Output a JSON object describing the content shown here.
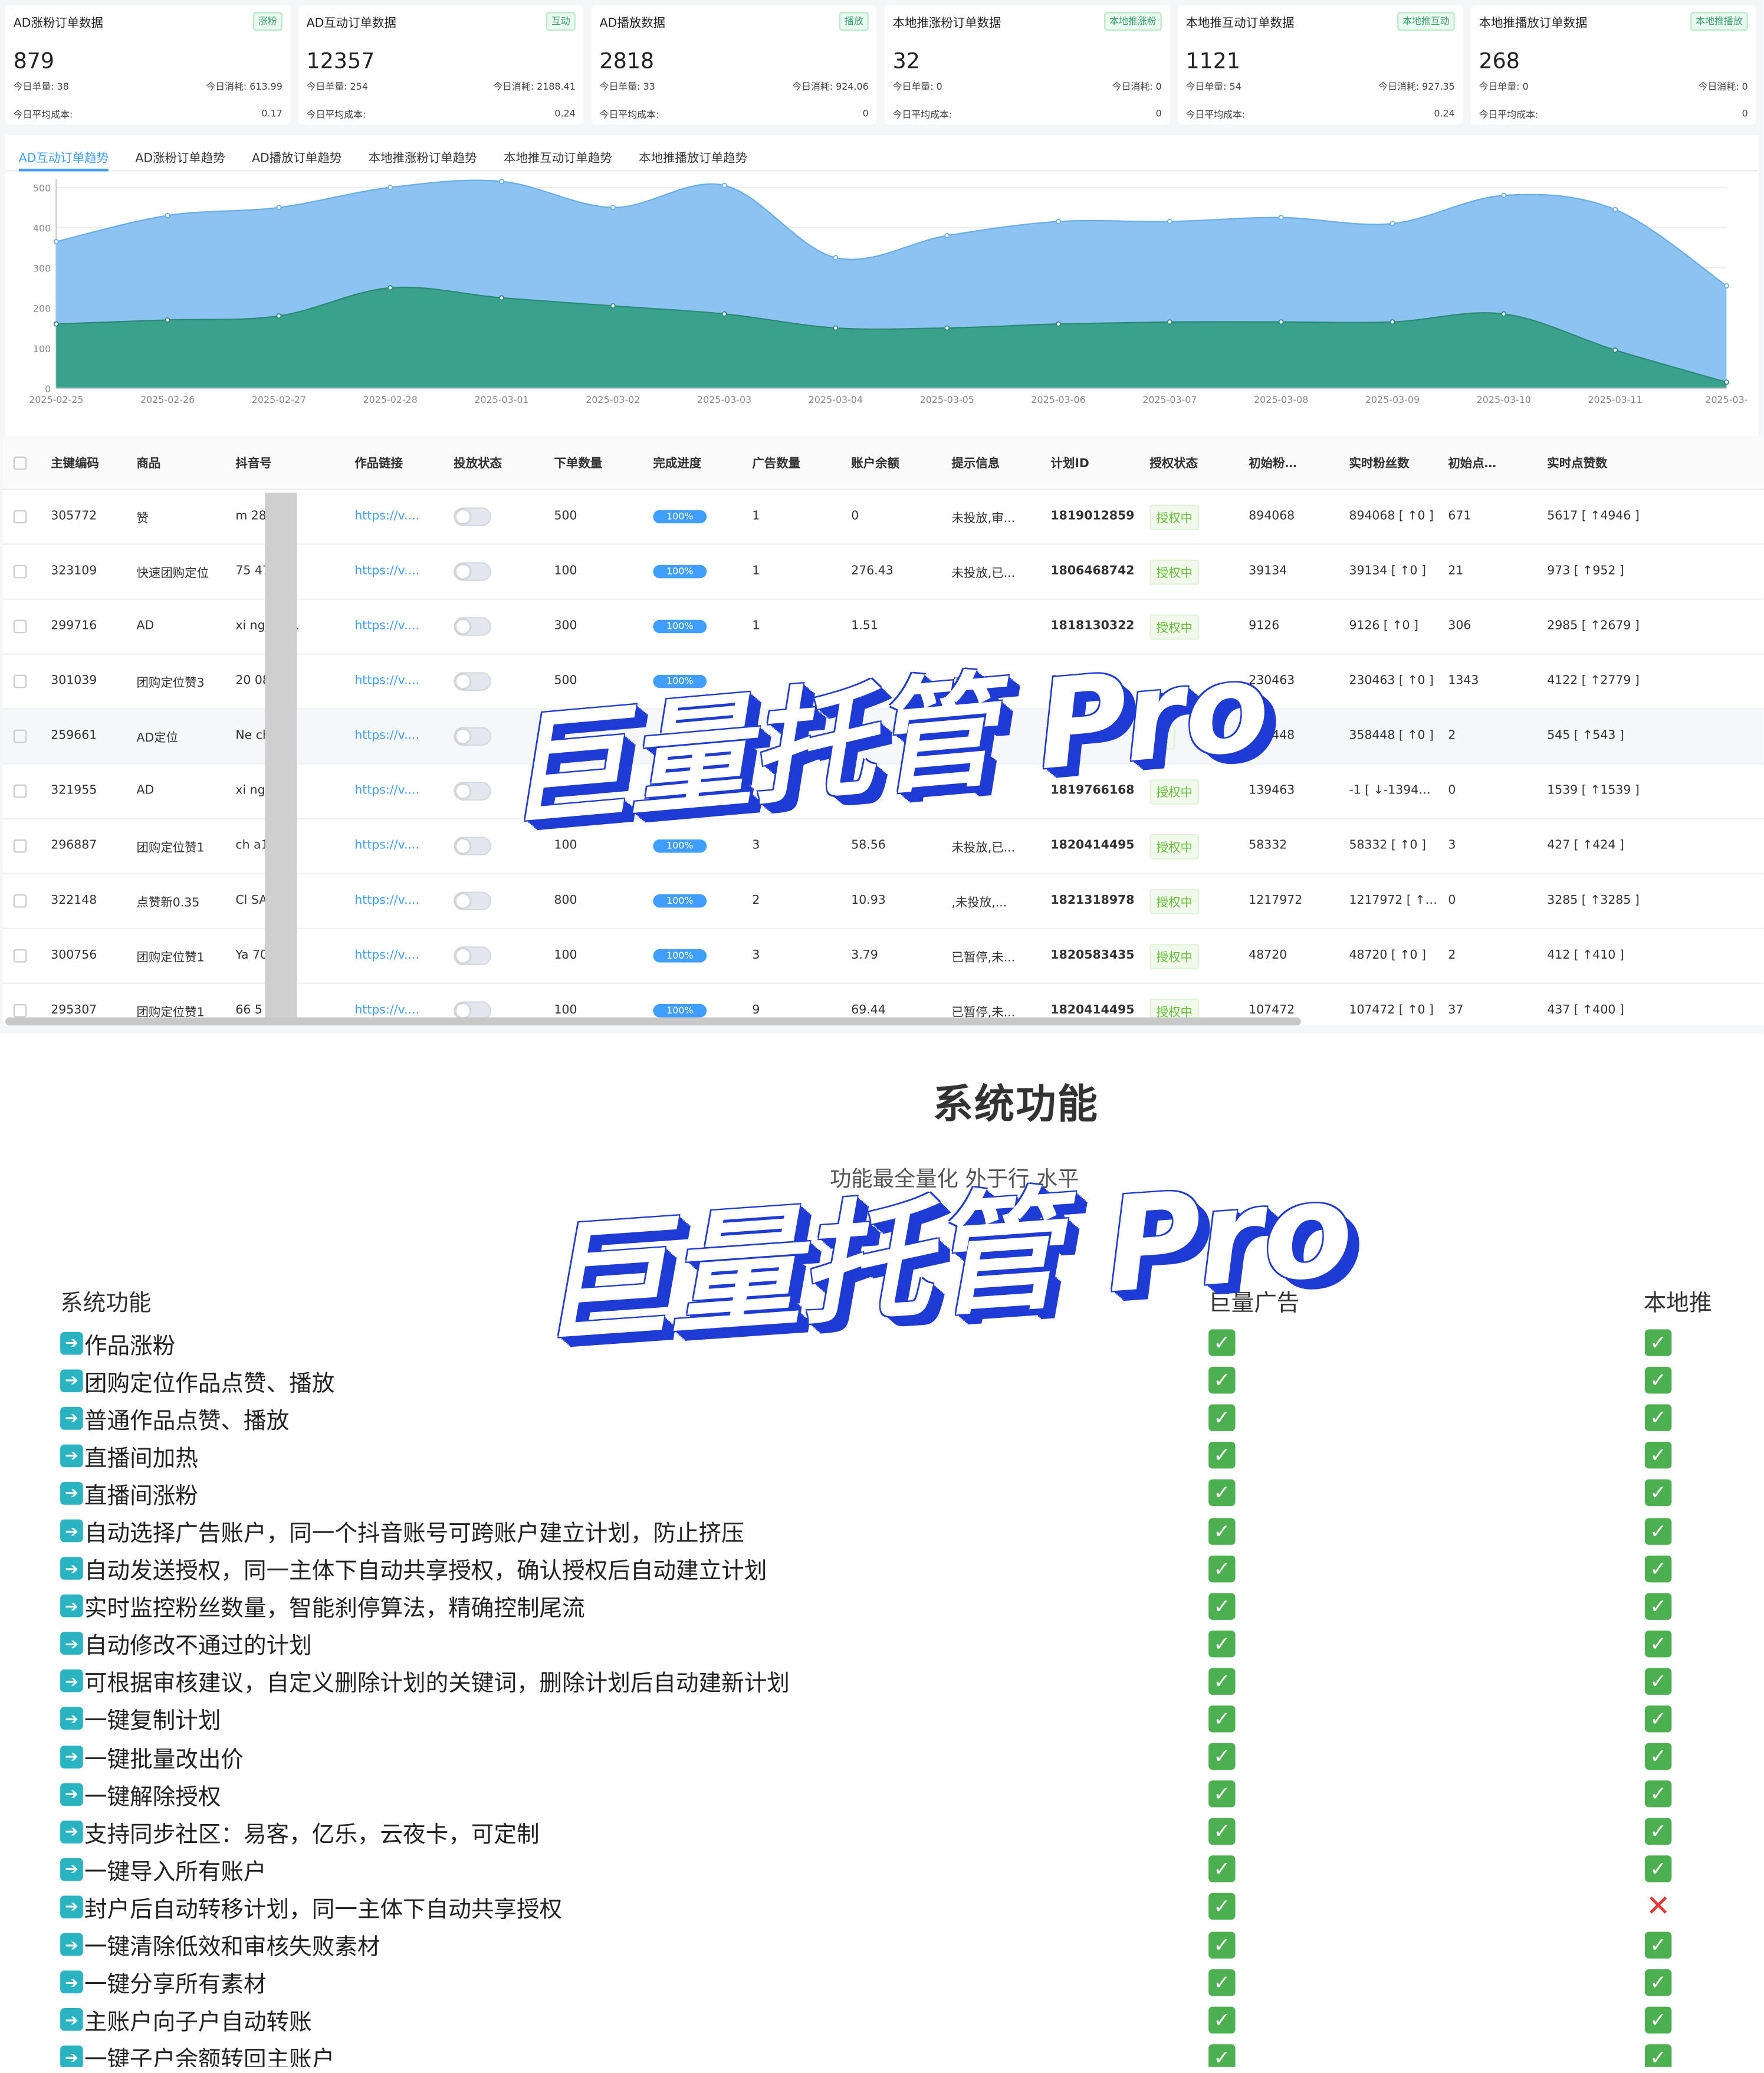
{
  "cards": [
    {
      "title": "AD涨粉订单数据",
      "tag": "涨粉",
      "value": "879",
      "orders": "今日单量: 38",
      "cost": "今日消耗: 613.99",
      "avg_label": "今日平均成本:",
      "avg": "0.17"
    },
    {
      "title": "AD互动订单数据",
      "tag": "互动",
      "value": "12357",
      "orders": "今日单量: 254",
      "cost": "今日消耗: 2188.41",
      "avg_label": "今日平均成本:",
      "avg": "0.24"
    },
    {
      "title": "AD播放数据",
      "tag": "播放",
      "value": "2818",
      "orders": "今日单量: 33",
      "cost": "今日消耗: 924.06",
      "avg_label": "今日平均成本:",
      "avg": "0"
    },
    {
      "title": "本地推涨粉订单数据",
      "tag": "本地推涨粉",
      "value": "32",
      "orders": "今日单量: 0",
      "cost": "今日消耗: 0",
      "avg_label": "今日平均成本:",
      "avg": "0"
    },
    {
      "title": "本地推互动订单数据",
      "tag": "本地推互动",
      "value": "1121",
      "orders": "今日单量: 54",
      "cost": "今日消耗: 927.35",
      "avg_label": "今日平均成本:",
      "avg": "0.24"
    },
    {
      "title": "本地推播放订单数据",
      "tag": "本地推播放",
      "value": "268",
      "orders": "今日单量: 0",
      "cost": "今日消耗: 0",
      "avg_label": "今日平均成本:",
      "avg": "0"
    }
  ],
  "tabs": [
    "AD互动订单趋势",
    "AD涨粉订单趋势",
    "AD播放订单趋势",
    "本地推涨粉订单趋势",
    "本地推互动订单趋势",
    "本地推播放订单趋势"
  ],
  "chart_data": {
    "type": "area",
    "x": [
      "2025-02-25",
      "2025-02-26",
      "2025-02-27",
      "2025-02-28",
      "2025-03-01",
      "2025-03-02",
      "2025-03-03",
      "2025-03-04",
      "2025-03-05",
      "2025-03-06",
      "2025-03-07",
      "2025-03-08",
      "2025-03-09",
      "2025-03-10",
      "2025-03-11",
      "2025-03-"
    ],
    "yticks": [
      "0",
      "100",
      "200",
      "300",
      "400",
      "500"
    ],
    "ylim": [
      0,
      500
    ],
    "series": [
      {
        "values": [
          365,
          430,
          450,
          500,
          515,
          450,
          505,
          325,
          380,
          415,
          415,
          425,
          410,
          480,
          445,
          255
        ],
        "color": "#8cc3f2"
      },
      {
        "values": [
          160,
          170,
          180,
          250,
          225,
          205,
          185,
          150,
          150,
          160,
          165,
          165,
          165,
          185,
          95,
          15
        ],
        "color": "#3aa18c"
      }
    ]
  },
  "table": {
    "headers": [
      "主键编码",
      "商品",
      "抖音号",
      "作品链接",
      "投放状态",
      "下单数量",
      "完成进度",
      "广告数量",
      "账户余额",
      "提示信息",
      "计划ID",
      "授权状态",
      "初始粉…",
      "实时粉丝数",
      "初始点…",
      "实时点赞数"
    ],
    "rows": [
      [
        "305772",
        "赞",
        "m      28",
        "https://v....",
        "",
        "500",
        "100%",
        "1",
        "0",
        "未投放,审...",
        "1819012859",
        "授权中",
        "894068",
        "894068 [ ↑0 ]",
        "671",
        "5617 [ ↑4946 ]"
      ],
      [
        "323109",
        "快速团购定位",
        "75      47825",
        "https://v....",
        "",
        "100",
        "100%",
        "1",
        "276.43",
        "未投放,已...",
        "1806468742",
        "授权中",
        "39134",
        "39134 [ ↑0 ]",
        "21",
        "973 [ ↑952 ]"
      ],
      [
        "299716",
        "AD",
        "xi      ngjun11",
        "https://v....",
        "",
        "300",
        "100%",
        "1",
        "1.51",
        "",
        "1818130322",
        "授权中",
        "9126",
        "9126 [ ↑0 ]",
        "306",
        "2985 [ ↑2679 ]"
      ],
      [
        "301039",
        "团购定位赞3",
        "20      08",
        "https://v....",
        "",
        "500",
        "100%",
        "",
        "",
        "停,未...",
        "18",
        "",
        "230463",
        "230463 [ ↑0 ]",
        "1343",
        "4122 [ ↑2779 ]"
      ],
      [
        "259661",
        "AD定位",
        "Ne      ch666",
        "https://v....",
        "",
        "",
        "",
        "",
        "",
        "投放,已",
        "18074668",
        "授",
        "358448",
        "358448 [ ↑0 ]",
        "2",
        "545 [ ↑543 ]"
      ],
      [
        "321955",
        "AD",
        "xi      ngjun1",
        "https://v....",
        "",
        "",
        "",
        "",
        "",
        "",
        "1819766168",
        "授权中",
        "139463",
        "-1 [ ↓-139464 ]",
        "0",
        "1539 [ ↑1539 ]"
      ],
      [
        "296887",
        "团购定位赞1",
        "ch      a1818",
        "https://v....",
        "",
        "100",
        "100%",
        "3",
        "58.56",
        "未投放,已...",
        "1820414495",
        "授权中",
        "58332",
        "58332 [ ↑0 ]",
        "3",
        "427 [ ↑424 ]"
      ],
      [
        "322148",
        "点赞新0.35",
        "Cl      SAN__L",
        "https://v....",
        "",
        "800",
        "100%",
        "2",
        "10.93",
        ",未投放,...",
        "1821318978",
        "授权中",
        "1217972",
        "1217972 [ ↑0 ]",
        "0",
        "3285 [ ↑3285 ]"
      ],
      [
        "300756",
        "团购定位赞1",
        "Ya      70",
        "https://v....",
        "",
        "100",
        "100%",
        "3",
        "3.79",
        "已暂停,未...",
        "1820583435",
        "授权中",
        "48720",
        "48720 [ ↑0 ]",
        "2",
        "412 [ ↑410 ]"
      ],
      [
        "295307",
        "团购定位赞1",
        "66      5",
        "https://v....",
        "",
        "100",
        "100%",
        "9",
        "69.44",
        "已暂停,未...",
        "1820414495",
        "授权中",
        "107472",
        "107472 [ ↑0 ]",
        "37",
        "437 [ ↑400 ]"
      ]
    ]
  },
  "watermark": "巨量托管 Pro",
  "section": {
    "title": "系统功能",
    "subtitle": "功能最全量化  外于行      水平",
    "col_feature": "系统功能",
    "col_a": "巨量广告",
    "col_b": "本地推",
    "features": [
      {
        "name": "作品涨粉",
        "a": true,
        "b": true
      },
      {
        "name": "团购定位作品点赞、播放",
        "a": true,
        "b": true
      },
      {
        "name": "普通作品点赞、播放",
        "a": true,
        "b": true
      },
      {
        "name": "直播间加热",
        "a": true,
        "b": true
      },
      {
        "name": "直播间涨粉",
        "a": true,
        "b": true
      },
      {
        "name": "自动选择广告账户，同一个抖音账号可跨账户建立计划，防止挤压",
        "a": true,
        "b": true
      },
      {
        "name": "自动发送授权，同一主体下自动共享授权，确认授权后自动建立计划",
        "a": true,
        "b": true
      },
      {
        "name": "实时监控粉丝数量，智能刹停算法，精确控制尾流",
        "a": true,
        "b": true
      },
      {
        "name": "自动修改不通过的计划",
        "a": true,
        "b": true
      },
      {
        "name": "可根据审核建议，自定义删除计划的关键词，删除计划后自动建新计划",
        "a": true,
        "b": true
      },
      {
        "name": "一键复制计划",
        "a": true,
        "b": true
      },
      {
        "name": "一键批量改出价",
        "a": true,
        "b": true
      },
      {
        "name": "一键解除授权",
        "a": true,
        "b": true
      },
      {
        "name": "支持同步社区：易客，亿乐，云夜卡，可定制",
        "a": true,
        "b": true
      },
      {
        "name": "一键导入所有账户",
        "a": true,
        "b": true
      },
      {
        "name": "封户后自动转移计划，同一主体下自动共享授权",
        "a": true,
        "b": false
      },
      {
        "name": "一键清除低效和审核失败素材",
        "a": true,
        "b": true
      },
      {
        "name": "一键分享所有素材",
        "a": true,
        "b": true
      },
      {
        "name": "主账户向子户自动转账",
        "a": true,
        "b": true
      },
      {
        "name": "一键子户余额转回主账户",
        "a": true,
        "b": true
      }
    ]
  }
}
